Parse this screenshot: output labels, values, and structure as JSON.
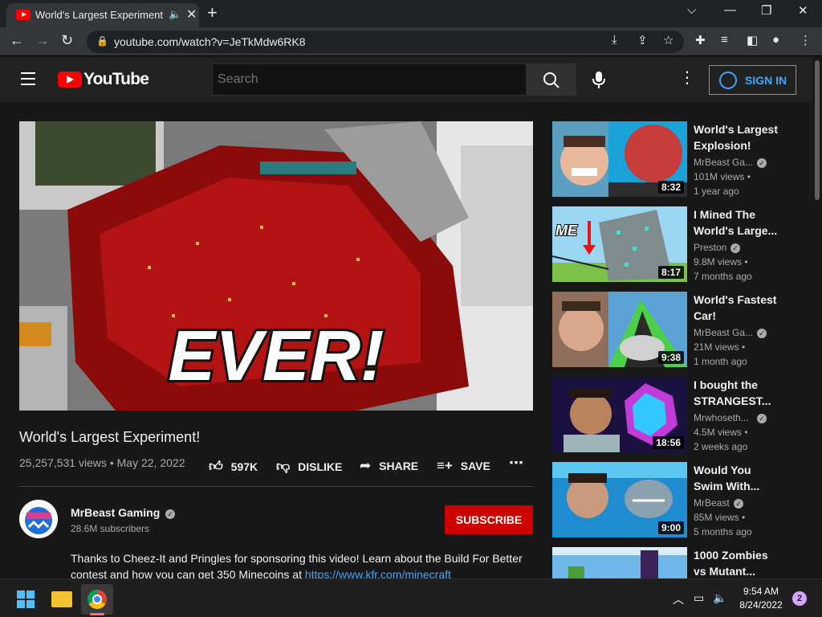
{
  "browser": {
    "tab_title": "World's Largest Experiment!",
    "url": "youtube.com/watch?v=JeTkMdw6RK8"
  },
  "youtube": {
    "logo_text": "YouTube",
    "search_placeholder": "Search",
    "sign_in_label": "SIGN IN"
  },
  "video": {
    "overlay_text": "EVER!",
    "title": "World's Largest Experiment!",
    "views_date": "25,257,531 views • May 22, 2022",
    "likes": "597K",
    "dislike_label": "DISLIKE",
    "share_label": "SHARE",
    "save_label": "SAVE",
    "channel_name": "MrBeast Gaming",
    "subscribers": "28.6M subscribers",
    "subscribe_label": "SUBSCRIBE",
    "description": "Thanks to Cheez-It and Pringles for sponsoring this video! Learn about the Build For Better contest and how you can get 350 Minecoins at ",
    "description_link": "https://www.kfr.com/minecraft"
  },
  "recommendations": [
    {
      "title": "World's Largest Explosion!",
      "channel": "MrBeast Ga...",
      "views": "101M views •",
      "age": "1 year ago",
      "duration": "8:32"
    },
    {
      "title": "I Mined The World's Large...",
      "channel": "Preston",
      "views": "9.8M views •",
      "age": "7 months ago",
      "duration": "8:17"
    },
    {
      "title": "World's Fastest Car!",
      "channel": "MrBeast Ga...",
      "views": "21M views •",
      "age": "1 month ago",
      "duration": "9:38"
    },
    {
      "title": "I bought the STRANGEST...",
      "channel": "Mrwhoseth...",
      "views": "4.5M views •",
      "age": "2 weeks ago",
      "duration": "18:56"
    },
    {
      "title": "Would You Swim With...",
      "channel": "MrBeast",
      "views": "85M views •",
      "age": "5 months ago",
      "duration": "9:00"
    },
    {
      "title": "1000 Zombies vs Mutant...",
      "channel": "",
      "views": "",
      "age": "",
      "duration": ""
    }
  ],
  "thumb_labels": {
    "rec2_me": "ME"
  },
  "taskbar": {
    "time": "9:54 AM",
    "date": "8/24/2022",
    "notification_count": "2"
  },
  "colors": {
    "accent_blue": "#3ea6ff",
    "subscribe_red": "#cc0000",
    "youtube_red": "#ff0000"
  }
}
